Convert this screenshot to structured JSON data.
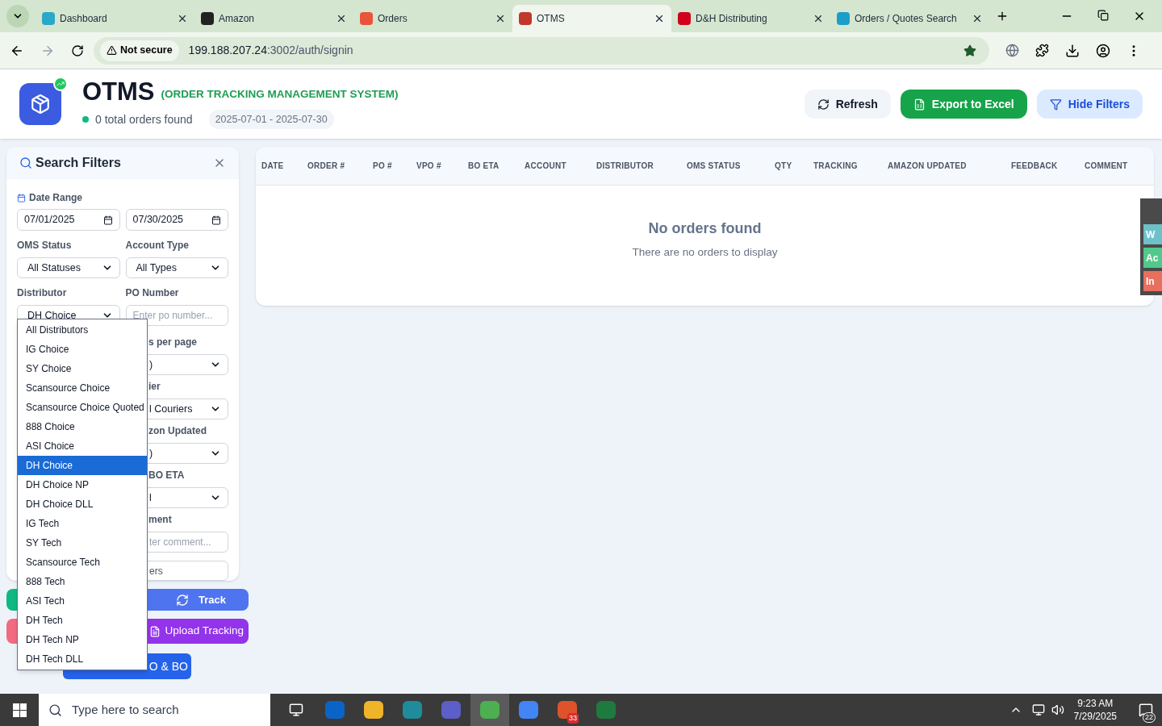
{
  "browser": {
    "tabs": [
      {
        "title": "Dashboard",
        "selected": false
      },
      {
        "title": "Amazon",
        "selected": false
      },
      {
        "title": "Orders",
        "selected": false
      },
      {
        "title": "OTMS",
        "selected": true
      },
      {
        "title": "D&H Distributing",
        "selected": false
      },
      {
        "title": "Orders / Quotes Search",
        "selected": false
      }
    ],
    "security": "Not secure",
    "url_host": "199.188.207.24",
    "url_path": ":3002/auth/signin"
  },
  "header": {
    "title": "OTMS",
    "subtitle": "(ORDER TRACKING MANAGEMENT SYSTEM)",
    "count": "0 total orders found",
    "date_range": "2025-07-01 - 2025-07-30",
    "buttons": [
      {
        "label": "Refresh",
        "kind": "neutral"
      },
      {
        "label": "Export to Excel",
        "kind": "primary"
      },
      {
        "label": "Hide Filters",
        "kind": "soft"
      }
    ]
  },
  "filters": {
    "title": "Search Filters",
    "date_label": "Date Range",
    "date_from": "07/01/2025",
    "date_to": "07/30/2025",
    "oms_status": {
      "label": "OMS Status",
      "value": "All Statuses"
    },
    "account_type": {
      "label": "Account Type",
      "value": "All Types"
    },
    "distributor": {
      "label": "Distributor",
      "value": "DH Choice"
    },
    "po_number": {
      "label": "PO Number",
      "placeholder": "Enter po number..."
    },
    "partial_fields": [
      {
        "label": "s per page",
        "kind": "select",
        "value": ")"
      },
      {
        "label": "ier",
        "kind": "select",
        "value": "l Couriers"
      },
      {
        "label": "zon Updated",
        "kind": "select",
        "value": ")"
      },
      {
        "label": "BO ETA",
        "kind": "select",
        "value": "l"
      },
      {
        "label": "ment",
        "kind": "input",
        "placeholder": "ter comment..."
      }
    ],
    "partial_button": "ers"
  },
  "distributor_options": [
    {
      "label": "All Distributors",
      "selected": false
    },
    {
      "label": "IG Choice",
      "selected": false
    },
    {
      "label": "SY Choice",
      "selected": false
    },
    {
      "label": "Scansource Choice",
      "selected": false
    },
    {
      "label": "Scansource Choice Quoted",
      "selected": false
    },
    {
      "label": "888 Choice",
      "selected": false
    },
    {
      "label": "ASI Choice",
      "selected": false
    },
    {
      "label": "DH Choice",
      "selected": true
    },
    {
      "label": "DH Choice NP",
      "selected": false
    },
    {
      "label": "DH Choice DLL",
      "selected": false
    },
    {
      "label": "IG Tech",
      "selected": false
    },
    {
      "label": "SY Tech",
      "selected": false
    },
    {
      "label": "Scansource Tech",
      "selected": false
    },
    {
      "label": "888 Tech",
      "selected": false
    },
    {
      "label": "ASI Tech",
      "selected": false
    },
    {
      "label": "DH Tech",
      "selected": false
    },
    {
      "label": "DH Tech NP",
      "selected": false
    },
    {
      "label": "DH Tech DLL",
      "selected": false
    }
  ],
  "actions": {
    "track": "Track",
    "upload_tracking": "Upload Tracking",
    "upload_vpo_partial": "O & BO"
  },
  "table": {
    "columns": [
      "DATE",
      "ORDER #",
      "PO #",
      "VPO #",
      "BO ETA",
      "ACCOUNT",
      "DISTRIBUTOR",
      "OMS STATUS",
      "QTY",
      "TRACKING",
      "AMAZON UPDATED",
      "FEEDBACK",
      "COMMENT"
    ],
    "empty_title": "No orders found",
    "empty_message": "There are no orders to display"
  },
  "side_widget": [
    {
      "label": "W",
      "color": "#6ec1c9"
    },
    {
      "label": "Ac",
      "color": "#52c98a"
    },
    {
      "label": "In",
      "color": "#e8705f"
    }
  ],
  "taskbar": {
    "search_placeholder": "Type here to search",
    "badge": "33",
    "time": "9:23 AM",
    "date": "7/29/2025",
    "notifications": "22"
  }
}
